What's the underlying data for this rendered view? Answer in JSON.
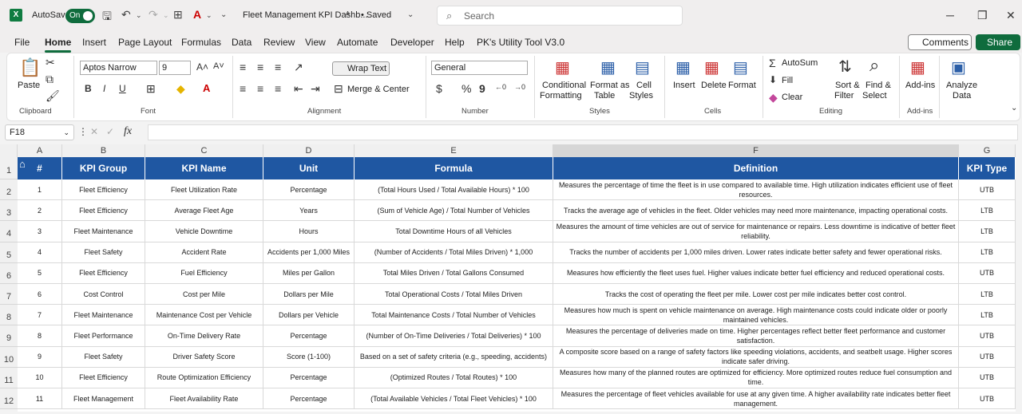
{
  "window": {
    "autosave_label": "AutoSave",
    "toggle_label": "On",
    "doc_title": "Fleet Management KPI Dashb...",
    "saved_label": "• Saved",
    "search_placeholder": "Search"
  },
  "menu": [
    "File",
    "Home",
    "Insert",
    "Page Layout",
    "Formulas",
    "Data",
    "Review",
    "View",
    "Automate",
    "Developer",
    "Help",
    "PK's Utility Tool V3.0"
  ],
  "comments_label": "Comments",
  "share_label": "Share",
  "ribbon": {
    "paste": "Paste",
    "clipboard": "Clipboard",
    "font_name": "Aptos Narrow",
    "font_size": "9",
    "font": "Font",
    "wrap_text": "Wrap Text",
    "merge_center": "Merge & Center",
    "alignment": "Alignment",
    "number_format": "General",
    "number": "Number",
    "conditional": "Conditional",
    "formatting": "Formatting",
    "format_as": "Format as",
    "table": "Table",
    "cell": "Cell",
    "styles_btn": "Styles",
    "styles": "Styles",
    "insert": "Insert",
    "delete": "Delete",
    "format": "Format",
    "cells": "Cells",
    "autosum": "AutoSum",
    "fill": "Fill",
    "clear": "Clear",
    "sort": "Sort &",
    "filter": "Filter",
    "find": "Find &",
    "select": "Select",
    "editing": "Editing",
    "addins": "Add-ins",
    "addins_grp": "Add-ins",
    "analyze": "Analyze",
    "data": "Data"
  },
  "namebox": "F18",
  "fx": "fx",
  "columns": [
    "A",
    "B",
    "C",
    "D",
    "E",
    "F",
    "G"
  ],
  "row_numbers": [
    "1",
    "2",
    "3",
    "4",
    "5",
    "6",
    "7",
    "8",
    "9",
    "10",
    "11",
    "12"
  ],
  "headers": [
    "#",
    "KPI Group",
    "KPI Name",
    "Unit",
    "Formula",
    "Definition",
    "KPI Type"
  ],
  "rows": [
    [
      "1",
      "Fleet Efficiency",
      "Fleet Utilization Rate",
      "Percentage",
      "(Total Hours Used / Total Available Hours) * 100",
      "Measures the percentage of time the fleet is in use compared to available time. High utilization indicates efficient use of fleet resources.",
      "UTB"
    ],
    [
      "2",
      "Fleet Efficiency",
      "Average Fleet Age",
      "Years",
      "(Sum of Vehicle Age) / Total Number of Vehicles",
      "Tracks the average age of vehicles in the fleet. Older vehicles may need more maintenance, impacting operational costs.",
      "LTB"
    ],
    [
      "3",
      "Fleet Maintenance",
      "Vehicle Downtime",
      "Hours",
      "Total Downtime Hours of all Vehicles",
      "Measures the amount of time vehicles are out of service for maintenance or repairs. Less downtime is indicative of better fleet reliability.",
      "LTB"
    ],
    [
      "4",
      "Fleet Safety",
      "Accident Rate",
      "Accidents per 1,000 Miles",
      "(Number of Accidents / Total Miles Driven) * 1,000",
      "Tracks the number of accidents per 1,000 miles driven. Lower rates indicate better safety and fewer operational risks.",
      "LTB"
    ],
    [
      "5",
      "Fleet Efficiency",
      "Fuel Efficiency",
      "Miles per Gallon",
      "Total Miles Driven / Total Gallons Consumed",
      "Measures how efficiently the fleet uses fuel. Higher values indicate better fuel efficiency and reduced operational costs.",
      "UTB"
    ],
    [
      "6",
      "Cost Control",
      "Cost per Mile",
      "Dollars per Mile",
      "Total Operational Costs / Total Miles Driven",
      "Tracks the cost of operating the fleet per mile. Lower cost per mile indicates better cost control.",
      "LTB"
    ],
    [
      "7",
      "Fleet Maintenance",
      "Maintenance Cost per Vehicle",
      "Dollars per Vehicle",
      "Total Maintenance Costs / Total Number of Vehicles",
      "Measures how much is spent on vehicle maintenance on average. High maintenance costs could indicate older or poorly maintained vehicles.",
      "LTB"
    ],
    [
      "8",
      "Fleet Performance",
      "On-Time Delivery Rate",
      "Percentage",
      "(Number of On-Time Deliveries / Total Deliveries) * 100",
      "Measures the percentage of deliveries made on time. Higher percentages reflect better fleet performance and customer satisfaction.",
      "UTB"
    ],
    [
      "9",
      "Fleet Safety",
      "Driver Safety Score",
      "Score (1-100)",
      "Based on a set of safety criteria (e.g., speeding, accidents)",
      "A composite score based on a range of safety factors like speeding violations, accidents, and seatbelt usage. Higher scores indicate safer driving.",
      "UTB"
    ],
    [
      "10",
      "Fleet Efficiency",
      "Route Optimization Efficiency",
      "Percentage",
      "(Optimized Routes / Total Routes) * 100",
      "Measures how many of the planned routes are optimized for efficiency. More optimized routes reduce fuel consumption and time.",
      "UTB"
    ],
    [
      "11",
      "Fleet Management",
      "Fleet Availability Rate",
      "Percentage",
      "(Total Available Vehicles / Total Fleet Vehicles) * 100",
      "Measures the percentage of fleet vehicles available for use at any given time. A higher availability rate indicates better fleet management.",
      "UTB"
    ]
  ]
}
